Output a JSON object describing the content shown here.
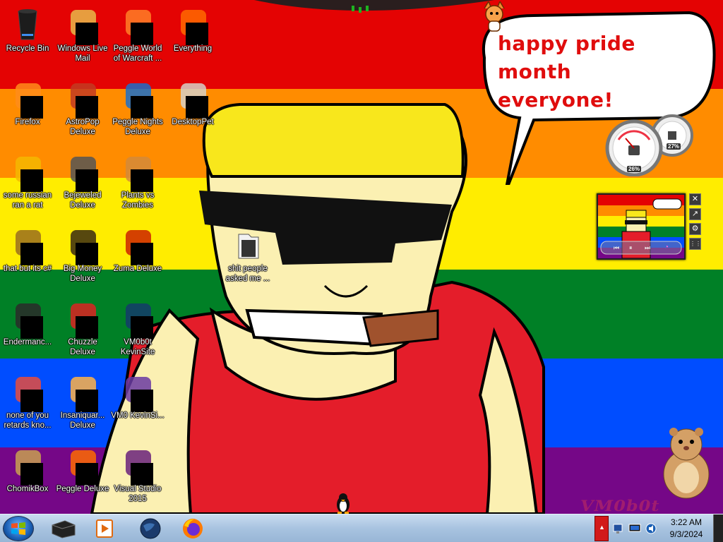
{
  "wallpaper": {
    "stripes": [
      "#e40303",
      "#ff8c00",
      "#ffed00",
      "#008026",
      "#004dff",
      "#750787"
    ],
    "bubble_text_line1": "happy pride month",
    "bubble_text_line2": "everyone!",
    "watermark": "VM0b0t"
  },
  "desktop_icons": [
    {
      "label": "Recycle Bin",
      "icon": "recycle-bin-icon"
    },
    {
      "label": "Windows Live Mail",
      "icon": "mail-icon"
    },
    {
      "label": "Peggle World of Warcraft ...",
      "icon": "peggle-icon"
    },
    {
      "label": "Everything",
      "icon": "search-icon"
    },
    {
      "label": "Firefox",
      "icon": "firefox-icon"
    },
    {
      "label": "AstroPop Deluxe",
      "icon": "astropop-icon"
    },
    {
      "label": "Peggle Nights Deluxe",
      "icon": "peggle-nights-icon"
    },
    {
      "label": "DesktopPet",
      "icon": "desktop-pet-icon"
    },
    {
      "label": "some russian ran a rat",
      "icon": "app-icon"
    },
    {
      "label": "Bejeweled Deluxe",
      "icon": "bejeweled-icon"
    },
    {
      "label": "Plants vs Zombies",
      "icon": "pvz-icon"
    },
    {
      "label": "that but its c#",
      "icon": "shortcut-icon"
    },
    {
      "label": "Big Money Deluxe",
      "icon": "money-bag-icon"
    },
    {
      "label": "Zuma Deluxe",
      "icon": "zuma-icon"
    },
    {
      "label": "Endermanc...",
      "icon": "console-icon"
    },
    {
      "label": "Chuzzle Deluxe",
      "icon": "chuzzle-icon"
    },
    {
      "label": "VM0b0t KevinSite",
      "icon": "website-icon"
    },
    {
      "label": "none of you retards kno...",
      "icon": "app-icon"
    },
    {
      "label": "Insaniquar... Deluxe",
      "icon": "insaniquarium-icon"
    },
    {
      "label": "VM0 KevinSi...",
      "icon": "visual-studio-icon"
    },
    {
      "label": "ChomikBox",
      "icon": "chomikbox-icon"
    },
    {
      "label": "Peggle Deluxe",
      "icon": "peggle-icon"
    },
    {
      "label": "Visual Studio 2015",
      "icon": "visual-studio-icon"
    },
    {
      "label": "shit people asked me ...",
      "icon": "folder-icon"
    }
  ],
  "gadgets": {
    "cpu_percent": "26%",
    "memory_percent": "27%"
  },
  "taskbar": {
    "apps": [
      "explorer-icon",
      "media-player-icon",
      "globe-icon",
      "firefox-icon"
    ],
    "time": "3:22 AM",
    "date": "9/3/2024"
  }
}
